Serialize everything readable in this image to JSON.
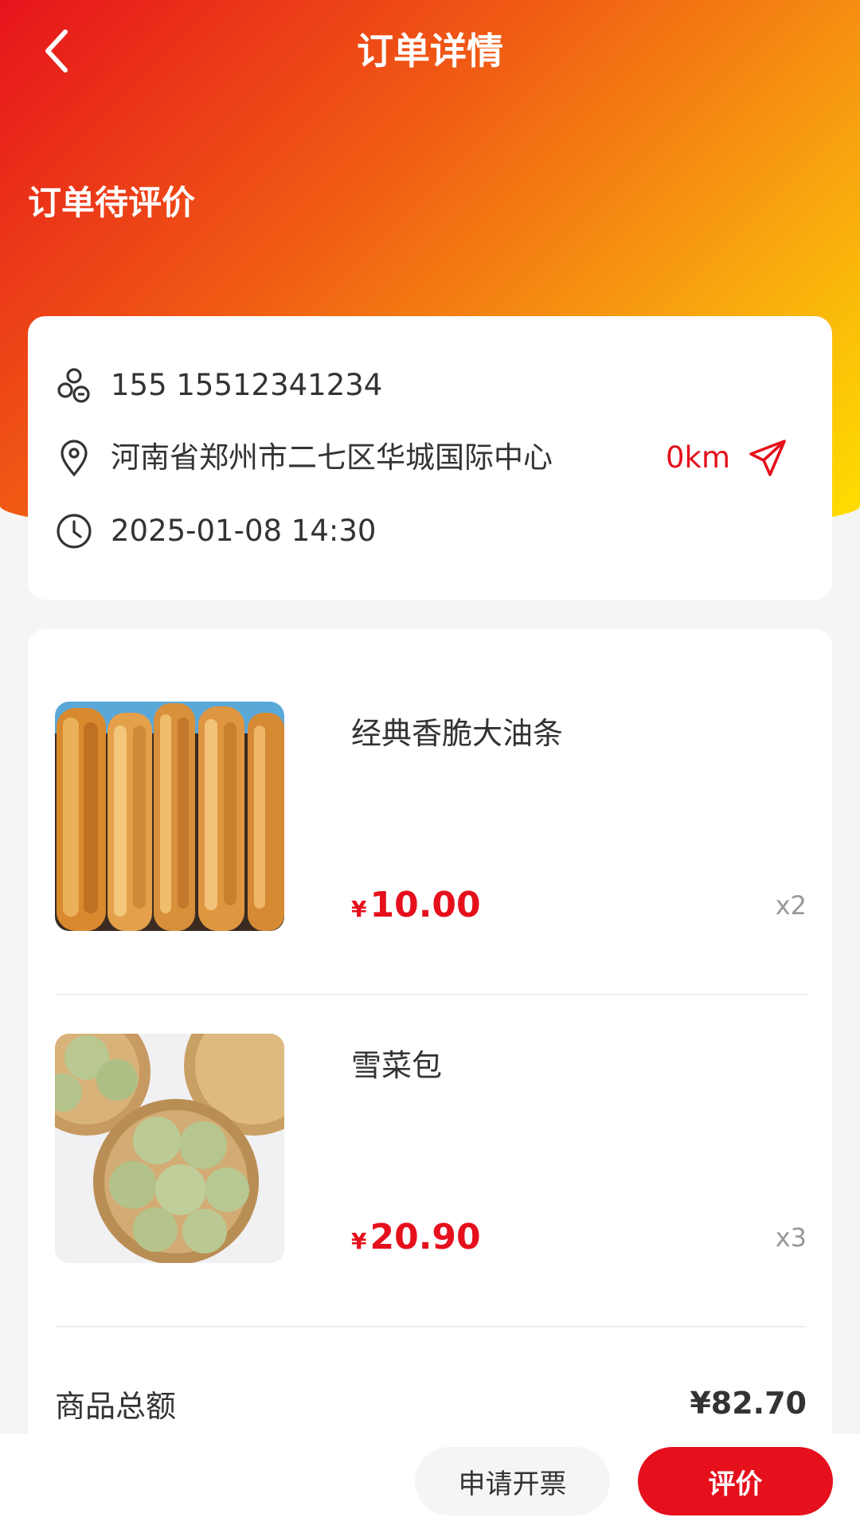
{
  "nav": {
    "title": "订单详情"
  },
  "status": {
    "text": "订单待评价"
  },
  "info": {
    "phone": "155 15512341234",
    "address": "河南省郑州市二七区华城国际中心",
    "distance": "0km",
    "time": "2025-01-08 14:30"
  },
  "goods": [
    {
      "name": "经典香脆大油条",
      "currency": "¥",
      "price": "10.00",
      "qty": "x2"
    },
    {
      "name": "雪菜包",
      "currency": "¥",
      "price": "20.90",
      "qty": "x3"
    }
  ],
  "total": {
    "label": "商品总额",
    "value": "¥82.70"
  },
  "actions": {
    "invoice": "申请开票",
    "review": "评价"
  },
  "colors": {
    "accent": "#e5101c",
    "gradient_start": "#e6141c",
    "gradient_end": "#ffe100"
  }
}
